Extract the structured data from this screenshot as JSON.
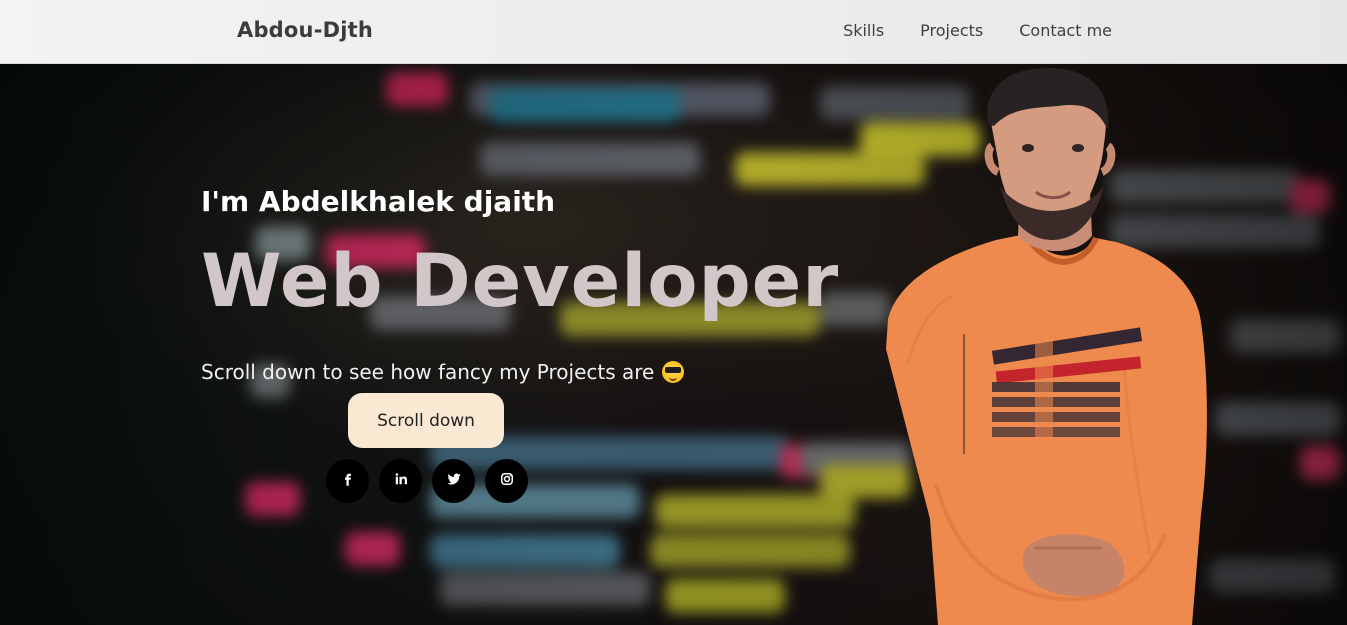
{
  "header": {
    "brand": "Abdou-Djth",
    "nav": [
      "Skills",
      "Projects",
      "Contact me"
    ]
  },
  "hero": {
    "intro": "I'm Abdelkhalek djaith",
    "role": "Web Developer",
    "tagline": "Scroll down to see how fancy my Projects are",
    "scroll_button": "Scroll down",
    "emoji": "smiling-face-with-sunglasses"
  },
  "social_icons": [
    "facebook-icon",
    "linkedin-icon",
    "twitter-icon",
    "instagram-icon"
  ],
  "colors": {
    "header_bg": "#eeeeef",
    "brand_text": "#3b3b3b",
    "role_text": "#d1c7c8",
    "button_bg": "#fbe8d2",
    "social_bg": "#000000",
    "shirt": "#ef8a4f"
  }
}
